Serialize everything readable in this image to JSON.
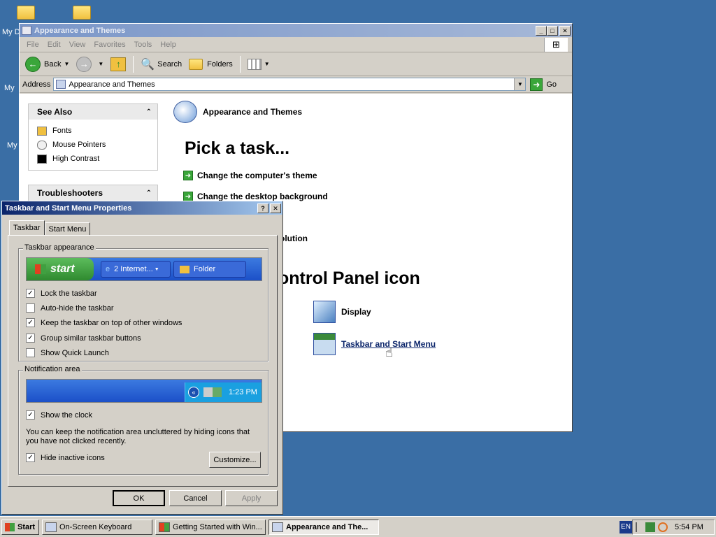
{
  "desktop": {
    "icons": [
      {
        "label": "My D"
      },
      {
        "label": "My"
      },
      {
        "label": "My"
      }
    ]
  },
  "explorer": {
    "title": "Appearance and Themes",
    "menu": [
      "File",
      "Edit",
      "View",
      "Favorites",
      "Tools",
      "Help"
    ],
    "toolbar": {
      "back": "Back",
      "search": "Search",
      "folders": "Folders"
    },
    "address": {
      "label": "Address",
      "value": "Appearance and Themes",
      "go": "Go"
    },
    "see_also": {
      "title": "See Also",
      "items": [
        "Fonts",
        "Mouse Pointers",
        "High Contrast"
      ]
    },
    "troubleshooters": {
      "title": "Troubleshooters"
    },
    "category_title": "Appearance and Themes",
    "pick_task": "Pick a task...",
    "tasks": [
      "Change the computer's theme",
      "Change the desktop background",
      "",
      "olution"
    ],
    "or_pick": "ontrol Panel icon",
    "cp_icons": [
      "Display",
      "Taskbar and Start Menu"
    ]
  },
  "dialog": {
    "title": "Taskbar and Start Menu Properties",
    "tabs": [
      "Taskbar",
      "Start Menu"
    ],
    "taskbar_appearance": {
      "label": "Taskbar appearance",
      "preview": {
        "start": "start",
        "item1": "2 Internet...",
        "item2": "Folder"
      },
      "options": [
        {
          "label": "Lock the taskbar",
          "checked": true
        },
        {
          "label": "Auto-hide the taskbar",
          "checked": false
        },
        {
          "label": "Keep the taskbar on top of other windows",
          "checked": true
        },
        {
          "label": "Group similar taskbar buttons",
          "checked": true
        },
        {
          "label": "Show Quick Launch",
          "checked": false
        }
      ]
    },
    "notification_area": {
      "label": "Notification area",
      "preview_time": "1:23 PM",
      "show_clock": {
        "label": "Show the clock",
        "checked": true
      },
      "description": "You can keep the notification area uncluttered by hiding icons that you have not clicked recently.",
      "hide_inactive": {
        "label": "Hide inactive icons",
        "checked": true
      },
      "customize": "Customize..."
    },
    "buttons": {
      "ok": "OK",
      "cancel": "Cancel",
      "apply": "Apply"
    }
  },
  "taskbar": {
    "start": "Start",
    "items": [
      "On-Screen Keyboard",
      "Getting Started with Win...",
      "Appearance and The..."
    ],
    "lang": "EN",
    "clock": "5:54 PM"
  },
  "colors": {
    "desktop": "#3a6ea5",
    "dialog_title": "#0a246a",
    "link": "#0a246a"
  }
}
